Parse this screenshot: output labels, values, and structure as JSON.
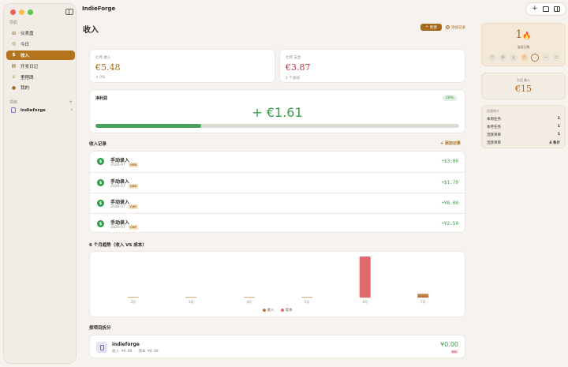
{
  "window": {
    "app_title": "IndieForge"
  },
  "sidebar": {
    "section_nav": "导航",
    "items": [
      {
        "label": "仪表盘",
        "icon": "grid-icon"
      },
      {
        "label": "今日",
        "icon": "check-circle-icon"
      },
      {
        "label": "收入",
        "icon": "dollar-icon",
        "active": true
      },
      {
        "label": "开发日记",
        "icon": "book-icon"
      },
      {
        "label": "里程碑",
        "icon": "trophy-icon"
      },
      {
        "label": "我的",
        "icon": "person-icon"
      }
    ],
    "section_projects": "项目",
    "add_symbol": "+",
    "project": {
      "name": "indieforge",
      "chevron": "›"
    }
  },
  "main": {
    "title": "收入",
    "new_button": "新建",
    "new_plus": "+",
    "add_button": "添加记录",
    "add_symbol": "+",
    "income_card": {
      "label": "七月 收入",
      "value": "€5.48",
      "sub": "↗ 0%"
    },
    "expense_card": {
      "label": "七月 支出",
      "value": "€3.87",
      "sub": "1 个滚动"
    },
    "net_card": {
      "label": "净利润",
      "percent": "29%",
      "value": "+ €1.61",
      "progress": 0.29
    },
    "records_heading": "收入记录",
    "records_add": "+ 添加记录",
    "records": [
      {
        "icon": "$",
        "title": "手动录入",
        "date": "2026-07",
        "badge": "USD",
        "amount": "+$3.00"
      },
      {
        "icon": "$",
        "title": "手动录入",
        "date": "2026-07",
        "badge": "USD",
        "amount": "+$1.70"
      },
      {
        "icon": "$",
        "title": "手动录入",
        "date": "2026-07",
        "badge": "CNY",
        "amount": "+¥8.00"
      },
      {
        "icon": "$",
        "title": "手动录入",
        "date": "2026-07",
        "badge": "CNY",
        "amount": "+¥2.50"
      }
    ],
    "trend_heading": "6 个月趋势（收入 VS 成本）",
    "project_heading": "按项目拆分",
    "project_card": {
      "name": "indieforge",
      "sub": "收入 ¥0.00 · 成本 ¥0.00",
      "value": "¥0.00",
      "percent": "0%"
    }
  },
  "chart_data": {
    "type": "bar",
    "categories": [
      "2月",
      "3月",
      "4月",
      "5月",
      "6月",
      "7月"
    ],
    "series": [
      {
        "name": "收入",
        "color": "#b67a3b",
        "values": [
          0,
          0,
          0,
          0,
          0,
          5.48
        ]
      },
      {
        "name": "成本",
        "color": "#e06a6e",
        "values": [
          0,
          0,
          0,
          0,
          60,
          3.87
        ]
      }
    ],
    "ylim": [
      0,
      60
    ],
    "legend": "bottom-center",
    "grid": false
  },
  "right_panel": {
    "streak": {
      "value": "1",
      "flame": "🔥",
      "label": "连续天数",
      "days": [
        "二",
        "四",
        "五",
        "六",
        "日",
        "一",
        "二"
      ],
      "done": [
        false,
        false,
        false,
        true,
        false,
        false,
        false
      ],
      "today_index": 4
    },
    "monthly": {
      "label": "七月 收入",
      "value": "€15"
    },
    "stats": {
      "title": "快速统计",
      "rows": [
        {
          "label": "本周任务",
          "value": "1"
        },
        {
          "label": "本月任务",
          "value": "1"
        },
        {
          "label": "活跃项目",
          "value": "1"
        },
        {
          "label": "活跃项目",
          "value": "4 条计"
        }
      ]
    }
  },
  "toolbar": {
    "plus": "+"
  },
  "colors": {
    "accent": "#b4731d",
    "positive": "#3d9a4a",
    "negative": "#c0303f"
  }
}
